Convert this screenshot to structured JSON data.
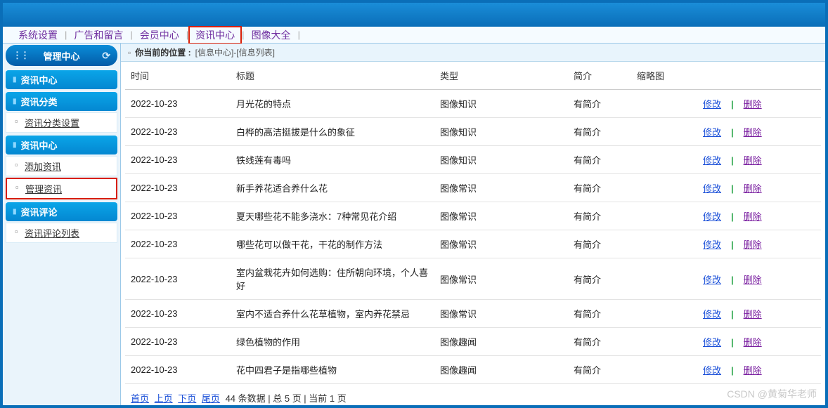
{
  "topnav": {
    "items": [
      "系统设置",
      "广告和留言",
      "会员中心",
      "资讯中心",
      "图像大全"
    ],
    "highlighted_index": 3
  },
  "sidebar": {
    "header": "管理中心",
    "title": "资讯中心",
    "groups": [
      {
        "header": "资讯分类",
        "items": [
          {
            "label": "资讯分类设置",
            "active": false
          }
        ]
      },
      {
        "header": "资讯中心",
        "items": [
          {
            "label": "添加资讯",
            "active": false
          },
          {
            "label": "管理资讯",
            "active": true
          }
        ]
      },
      {
        "header": "资讯评论",
        "items": [
          {
            "label": "资讯评论列表",
            "active": false
          }
        ]
      }
    ]
  },
  "breadcrumb": {
    "prefix": "你当前的位置 :",
    "path": "[信息中心]-[信息列表]"
  },
  "table": {
    "headers": {
      "time": "时间",
      "title": "标题",
      "type": "类型",
      "intro": "简介",
      "thumb": "缩略图",
      "ops": ""
    },
    "edit_label": "修改",
    "delete_label": "删除",
    "rows": [
      {
        "time": "2022-10-23",
        "title": "月光花的特点",
        "type": "图像知识",
        "intro": "有简介"
      },
      {
        "time": "2022-10-23",
        "title": "白桦的高洁挺拔是什么的象征",
        "type": "图像知识",
        "intro": "有简介"
      },
      {
        "time": "2022-10-23",
        "title": "铁线莲有毒吗",
        "type": "图像知识",
        "intro": "有简介"
      },
      {
        "time": "2022-10-23",
        "title": "新手养花适合养什么花",
        "type": "图像常识",
        "intro": "有简介"
      },
      {
        "time": "2022-10-23",
        "title": "夏天哪些花不能多浇水：7种常见花介绍",
        "type": "图像常识",
        "intro": "有简介"
      },
      {
        "time": "2022-10-23",
        "title": "哪些花可以做干花，干花的制作方法",
        "type": "图像常识",
        "intro": "有简介"
      },
      {
        "time": "2022-10-23",
        "title": "室内盆栽花卉如何选购：住所朝向环境，个人喜好",
        "type": "图像常识",
        "intro": "有简介"
      },
      {
        "time": "2022-10-23",
        "title": "室内不适合养什么花草植物，室内养花禁忌",
        "type": "图像常识",
        "intro": "有简介"
      },
      {
        "time": "2022-10-23",
        "title": "绿色植物的作用",
        "type": "图像趣闻",
        "intro": "有简介"
      },
      {
        "time": "2022-10-23",
        "title": "花中四君子是指哪些植物",
        "type": "图像趣闻",
        "intro": "有简介"
      }
    ]
  },
  "pager": {
    "first": "首页",
    "prev": "上页",
    "next": "下页",
    "last": "尾页",
    "info": "44 条数据 | 总 5 页 | 当前 1 页"
  },
  "watermark": "CSDN @黄菊华老师"
}
